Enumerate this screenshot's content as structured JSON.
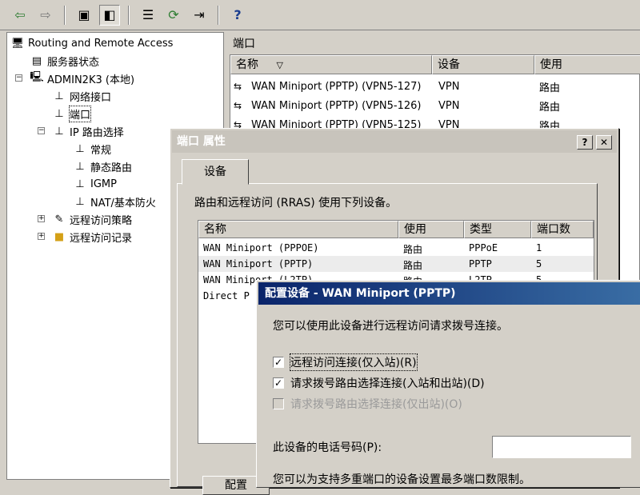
{
  "toolbar": {
    "buttons": [
      {
        "name": "back-icon",
        "glyph": "⇦"
      },
      {
        "name": "forward-icon",
        "glyph": "⇨"
      },
      {
        "name": "up-folder-icon",
        "glyph": "▣"
      },
      {
        "name": "show-tree-icon",
        "glyph": "◧"
      },
      {
        "name": "properties-icon",
        "glyph": "☰"
      },
      {
        "name": "refresh-icon",
        "glyph": "⟳"
      },
      {
        "name": "export-icon",
        "glyph": "⇥"
      },
      {
        "name": "help-icon",
        "glyph": "?"
      }
    ]
  },
  "tree": {
    "root": "Routing and Remote Access",
    "server_status": "服务器状态",
    "server": "ADMIN2K3 (本地)",
    "network_interfaces": "网络接口",
    "ports": "端口",
    "ip_routing": "IP 路由选择",
    "general": "常规",
    "static_routes": "静态路由",
    "igmp": "IGMP",
    "nat": "NAT/基本防火",
    "remote_policies": "远程访问策略",
    "remote_logging": "远程访问记录"
  },
  "ports_pane": {
    "title": "端口",
    "columns": {
      "name": "名称",
      "sort_glyph": "▽",
      "device": "设备",
      "used_by": "使用"
    },
    "rows": [
      {
        "name": "WAN Miniport (PPTP) (VPN5-127)",
        "device": "VPN",
        "used_by": "路由"
      },
      {
        "name": "WAN Miniport (PPTP) (VPN5-126)",
        "device": "VPN",
        "used_by": "路由"
      },
      {
        "name": "WAN Miniport (PPTP) (VPN5-125)",
        "device": "VPN",
        "used_by": "路由"
      }
    ]
  },
  "port_props_dialog": {
    "title": "端口 属性",
    "help_btn": "?",
    "close_btn": "✕",
    "tab": "设备",
    "description": "路由和远程访问 (RRAS) 使用下列设备。",
    "columns": {
      "name": "名称",
      "used_by": "使用",
      "type": "类型",
      "ports": "端口数"
    },
    "rows": [
      {
        "name": "WAN Miniport (PPPOE)",
        "used_by": "路由",
        "type": "PPPoE",
        "ports": "1"
      },
      {
        "name": "WAN Miniport (PPTP)",
        "used_by": "路由",
        "type": "PPTP",
        "ports": "5"
      },
      {
        "name": "WAN Miniport (L2TP)",
        "used_by": "路由",
        "type": "L2TP",
        "ports": "5"
      },
      {
        "name": "Direct P",
        "used_by": "",
        "type": "",
        "ports": ""
      }
    ],
    "configure_btn": "配置"
  },
  "config_dialog": {
    "title": "配置设备 - WAN Miniport (PPTP)",
    "intro": "您可以使用此设备进行远程访问请求拨号连接。",
    "opt_inbound": {
      "label": "远程访问连接(仅入站)(R)",
      "checked": true
    },
    "opt_demand_dial": {
      "label": "请求拨号路由选择连接(入站和出站)(D)",
      "checked": true
    },
    "opt_outbound": {
      "label": "请求拨号路由选择连接(仅出站)(O)",
      "checked": false
    },
    "phone_label": "此设备的电话号码(P):",
    "phone_value": "",
    "bottom_text": "您可以为支持多重端口的设备设置最多端口数限制。"
  }
}
